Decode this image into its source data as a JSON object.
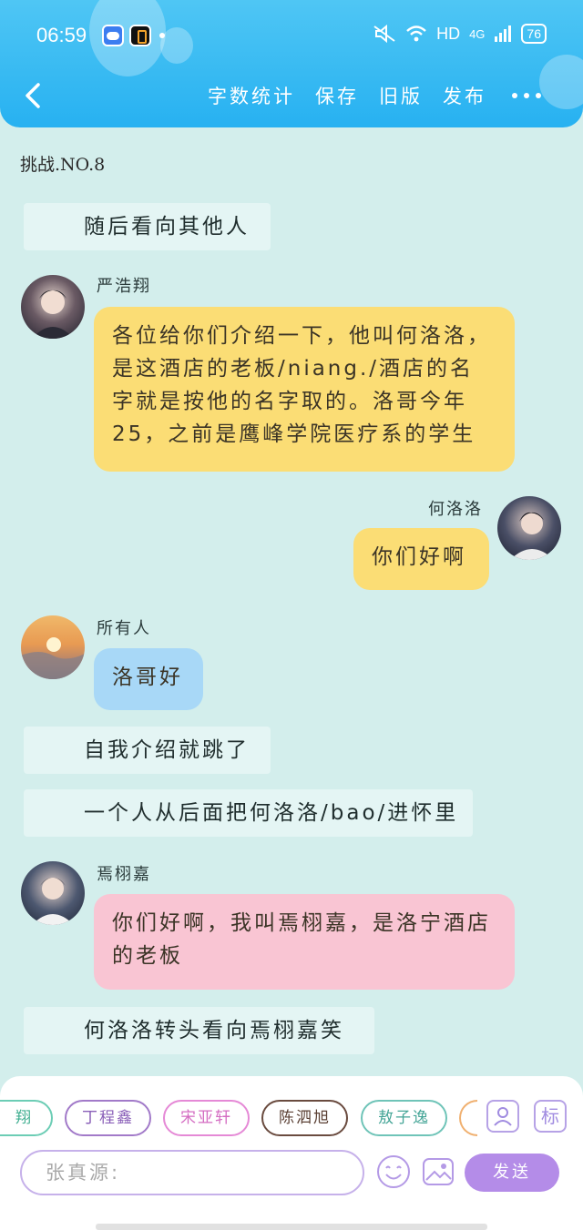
{
  "status_bar": {
    "time": "06:59",
    "network": "HD",
    "signal": "4G",
    "battery": "76"
  },
  "nav": {
    "actions": [
      "字数统计",
      "保存",
      "旧版",
      "发布"
    ]
  },
  "title": "挑战.NO.8",
  "messages": {
    "narration_1": "随后看向其他人",
    "msg1_name": "严浩翔",
    "msg1_text": "各位给你们介绍一下，他叫何洛洛，是这酒店的老板/niang./酒店的名字就是按他的名字取的。洛哥今年25，之前是鹰峰学院医疗系的学生",
    "msg2_name": "何洛洛",
    "msg2_text": "你们好啊",
    "msg3_name": "所有人",
    "msg3_text": "洛哥好",
    "narration_2": "自我介绍就跳了",
    "narration_3": "一个人从后面把何洛洛/bao/进怀里",
    "msg4_name": "焉栩嘉",
    "msg4_text": "你们好啊，我叫焉栩嘉，是洛宁酒店的老板",
    "narration_4": "何洛洛转头看向焉栩嘉笑"
  },
  "bottom": {
    "chips": [
      "翔",
      "丁程鑫",
      "宋亚轩",
      "陈泗旭",
      "敖子逸"
    ],
    "side_label": "标",
    "input_placeholder": "张真源:",
    "send_label": "发送"
  },
  "colors": {
    "header": "#27b1f1",
    "background": "#d3eeec",
    "yellow_bubble": "#fbdd75",
    "blue_bubble": "#a8d8f7",
    "pink_bubble": "#f9c5d3",
    "send_button": "#b48ce8"
  }
}
